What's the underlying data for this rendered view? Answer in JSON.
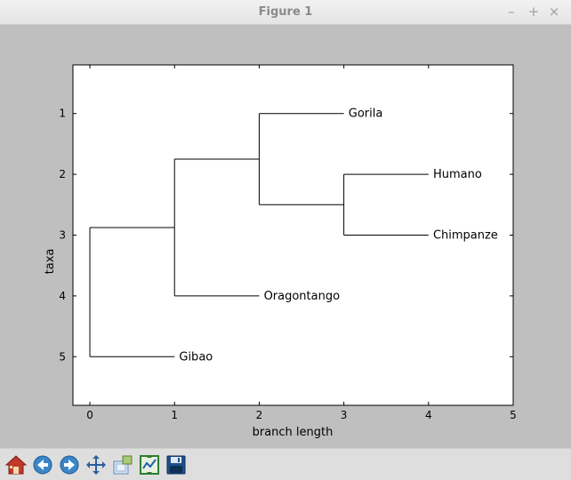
{
  "window": {
    "title": "Figure 1",
    "controls": {
      "minimize": "–",
      "maximize": "+",
      "close": "×"
    }
  },
  "chart_data": {
    "type": "dendrogram",
    "title": "",
    "xlabel": "branch length",
    "ylabel": "taxa",
    "xlim": [
      -0.2,
      5
    ],
    "ylim": [
      5.8,
      0.2
    ],
    "xticks": [
      0,
      1,
      2,
      3,
      4,
      5
    ],
    "yticks": [
      1,
      2,
      3,
      4,
      5
    ],
    "leaves": [
      {
        "name": "Gorila",
        "x": 2.97,
        "y": 1
      },
      {
        "name": "Humano",
        "x": 3.97,
        "y": 2
      },
      {
        "name": "Chimpanze",
        "x": 3.97,
        "y": 3
      },
      {
        "name": "Oragontango",
        "x": 1.97,
        "y": 4
      },
      {
        "name": "Gibao",
        "x": 0.97,
        "y": 5
      }
    ],
    "branches": [
      {
        "type": "v",
        "x": 0,
        "y1": 2.875,
        "y2": 5
      },
      {
        "type": "h",
        "y": 2.875,
        "x1": 0,
        "x2": 1
      },
      {
        "type": "h",
        "y": 5,
        "x1": 0,
        "x2": 1
      },
      {
        "type": "v",
        "x": 1,
        "y1": 1.75,
        "y2": 4
      },
      {
        "type": "h",
        "y": 1.75,
        "x1": 1,
        "x2": 2
      },
      {
        "type": "h",
        "y": 4,
        "x1": 1,
        "x2": 2
      },
      {
        "type": "v",
        "x": 2,
        "y1": 1,
        "y2": 2.5
      },
      {
        "type": "h",
        "y": 1,
        "x1": 2,
        "x2": 3
      },
      {
        "type": "h",
        "y": 2.5,
        "x1": 2,
        "x2": 3
      },
      {
        "type": "v",
        "x": 3,
        "y1": 2,
        "y2": 3
      },
      {
        "type": "h",
        "y": 2,
        "x1": 3,
        "x2": 4
      },
      {
        "type": "h",
        "y": 3,
        "x1": 3,
        "x2": 4
      }
    ],
    "grid": false,
    "colors": {
      "line": "#000000",
      "axes_bg": "#ffffff",
      "figure_bg": "#bfbfbf"
    }
  },
  "toolbar": {
    "buttons": [
      {
        "name": "home-button",
        "icon": "home-icon"
      },
      {
        "name": "back-button",
        "icon": "back-arrow-icon"
      },
      {
        "name": "forward-button",
        "icon": "forward-arrow-icon"
      },
      {
        "name": "pan-button",
        "icon": "pan-move-icon"
      },
      {
        "name": "zoom-button",
        "icon": "zoom-rect-icon"
      },
      {
        "name": "subplots-button",
        "icon": "subplots-config-icon"
      },
      {
        "name": "save-button",
        "icon": "save-floppy-icon"
      }
    ]
  }
}
